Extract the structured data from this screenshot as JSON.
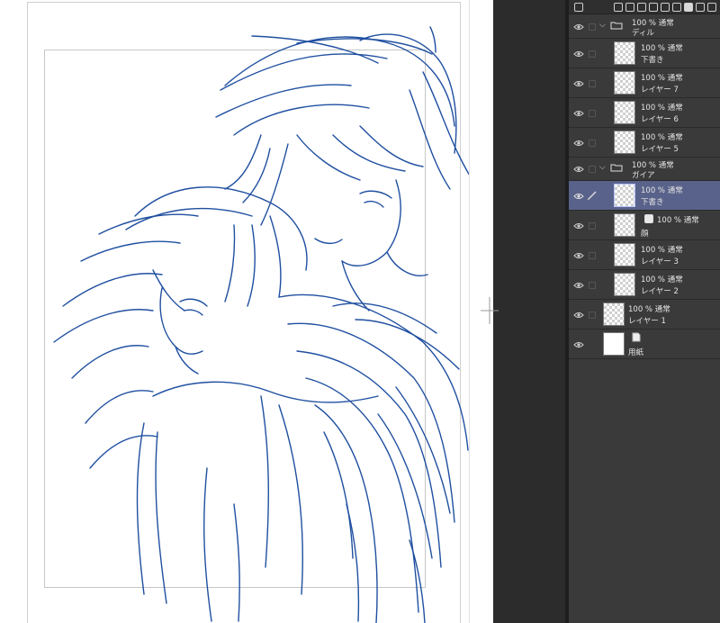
{
  "colors": {
    "ink": "#1f4fa0",
    "panel_bg": "#3a3a3a",
    "selected_row": "#59628a"
  },
  "toolbar_icons": [
    "layers-icon",
    "new-layer-icon",
    "new-vector-icon",
    "new-folder-icon",
    "mask-icon",
    "delete-icon"
  ],
  "layers": [
    {
      "kind": "folder",
      "mode": "100 % 通常",
      "name": "ディル"
    },
    {
      "kind": "raster",
      "mode": "100 % 通常",
      "name": "下書き"
    },
    {
      "kind": "raster",
      "mode": "100 % 通常",
      "name": "レイヤー 7"
    },
    {
      "kind": "raster",
      "mode": "100 % 通常",
      "name": "レイヤー 6"
    },
    {
      "kind": "raster",
      "mode": "100 % 通常",
      "name": "レイヤー 5"
    },
    {
      "kind": "folder",
      "mode": "100 % 通常",
      "name": "ガイア"
    },
    {
      "kind": "raster",
      "mode": "100 % 通常",
      "name": "下書き",
      "selected": true
    },
    {
      "kind": "raster",
      "mode": "100 % 通常",
      "name": "顔"
    },
    {
      "kind": "raster",
      "mode": "100 % 通常",
      "name": "レイヤー 3"
    },
    {
      "kind": "raster",
      "mode": "100 % 通常",
      "name": "レイヤー 2"
    },
    {
      "kind": "raster",
      "mode": "100 % 通常",
      "name": "レイヤー 1"
    },
    {
      "kind": "paper",
      "mode": "",
      "name": "用紙"
    }
  ]
}
